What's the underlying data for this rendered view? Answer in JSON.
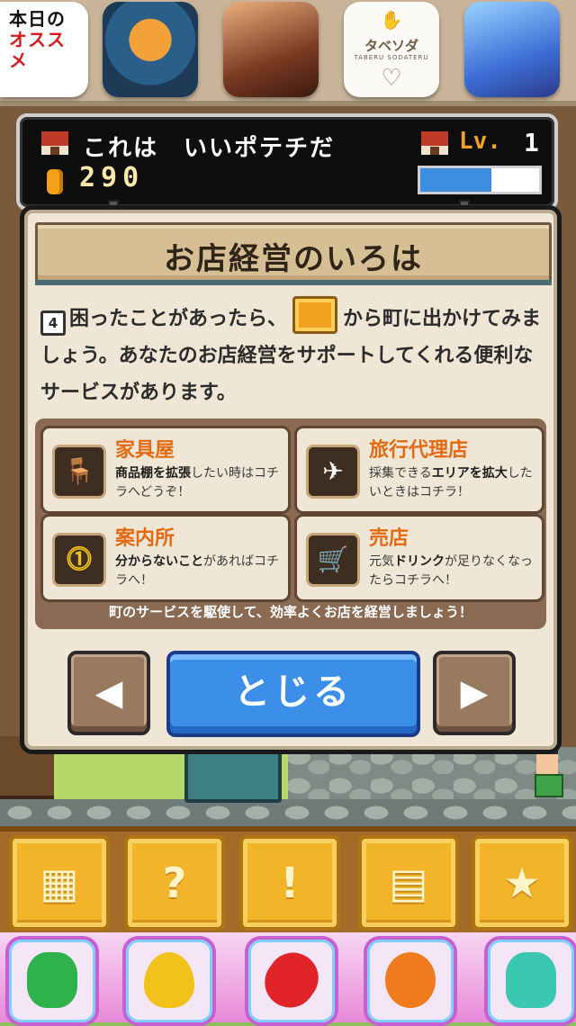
{
  "ads": {
    "items": [
      {
        "id": "ad-1",
        "lines": [
          "本日の",
          "オススメ"
        ],
        "icon": "recommend-logo-icon"
      },
      {
        "id": "ad-2",
        "icon": "planet-pixel-icon"
      },
      {
        "id": "ad-3",
        "icon": "romance-character-icon"
      },
      {
        "id": "ad-4",
        "title": "タベソダ",
        "subtitle": "TABERU SODATERU",
        "icon": "tabesoda-logo-icon"
      },
      {
        "id": "ad-5",
        "icon": "bubble-witch-icon"
      }
    ]
  },
  "hud": {
    "shop_name": "これは　いいポテチだ",
    "coins": "290",
    "level_label": "Lv.",
    "level_value": "1",
    "xp_progress": 0.6
  },
  "dialog": {
    "title": "お店経営のいろは",
    "page_badge": "4",
    "body_part1": "困ったことがあったら、",
    "body_part2": "から町に出かけてみましょう。あなたのお店経営をサポートしてくれる便利なサービスがあります。",
    "services": [
      {
        "title": "家具屋",
        "icon": "furniture-chair-icon",
        "desc_bold": "商品棚を拡張",
        "desc_rest": "したい時はコチラへどうぞ！"
      },
      {
        "title": "旅行代理店",
        "icon": "airplane-icon",
        "desc_pre": "採集できる",
        "desc_bold": "エリアを拡大",
        "desc_rest": "したいときはコチラ！"
      },
      {
        "title": "案内所",
        "icon": "exclamation-icon",
        "desc_bold": "分からないこと",
        "desc_rest": "があればコチラへ！"
      },
      {
        "title": "売店",
        "icon": "shopping-cart-icon",
        "desc_pre": "元気",
        "desc_bold": "ドリンク",
        "desc_rest": "が足りなくなったらコチラへ！"
      }
    ],
    "services_footer": "町のサービスを駆使して、効率よくお店を経営しましょう！",
    "prev_label": "◀",
    "next_label": "▶",
    "close_label": "とじる"
  },
  "menu": {
    "items": [
      {
        "name": "shop",
        "icon": "shop-building-icon"
      },
      {
        "name": "help",
        "icon": "question-sign-icon"
      },
      {
        "name": "events",
        "icon": "exclamation-characters-icon"
      },
      {
        "name": "town-map",
        "icon": "town-map-icon"
      },
      {
        "name": "favorites",
        "icon": "star-icon"
      }
    ]
  },
  "candy_bar": {
    "items": [
      {
        "name": "green-candy",
        "color": "#2fb24a"
      },
      {
        "name": "yellow-drop",
        "color": "#f2c21a"
      },
      {
        "name": "red-jelly",
        "color": "#e0242a"
      },
      {
        "name": "orange-candy",
        "color": "#f07a1e"
      },
      {
        "name": "teal-gummy-bear",
        "color": "#3ac9b0"
      }
    ]
  },
  "colors": {
    "accent_orange": "#e36a12",
    "button_blue": "#3b8fe8",
    "xp_blue": "#3d8ee3",
    "coin_gold": "#f1a21a"
  }
}
